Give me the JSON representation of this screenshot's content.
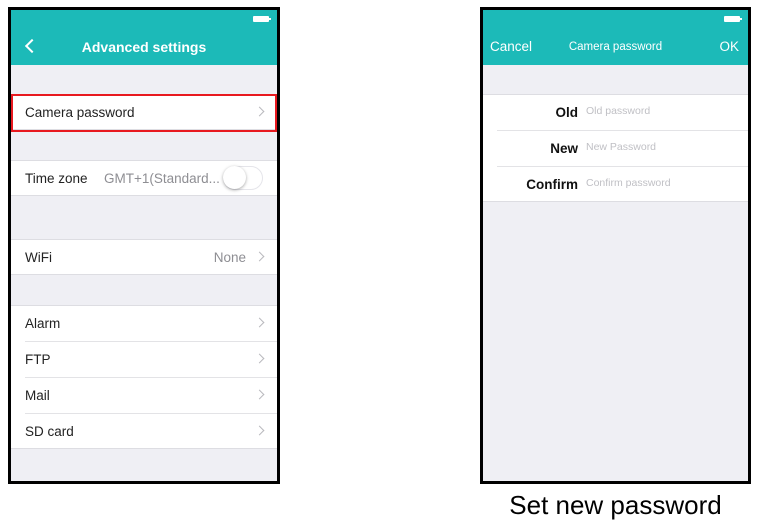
{
  "advanced_settings": {
    "title": "Advanced settings",
    "camera_password_label": "Camera password",
    "time_zone": {
      "label": "Time zone",
      "value": "GMT+1(Standard...",
      "enabled": false
    },
    "wifi": {
      "label": "WiFi",
      "value": "None"
    },
    "items": [
      {
        "label": "Alarm"
      },
      {
        "label": "FTP"
      },
      {
        "label": "Mail"
      },
      {
        "label": "SD card"
      }
    ]
  },
  "camera_password": {
    "cancel_label": "Cancel",
    "title": "Camera password",
    "ok_label": "OK",
    "fields": [
      {
        "label": "Old",
        "placeholder": "Old password",
        "value": ""
      },
      {
        "label": "New",
        "placeholder": "New Password",
        "value": ""
      },
      {
        "label": "Confirm",
        "placeholder": "Confirm password",
        "value": ""
      }
    ]
  },
  "caption": "Set new password",
  "colors": {
    "accent": "#1cbab8",
    "highlight": "#e8191f",
    "background": "#efeff4"
  },
  "icons": [
    "back-chevron-icon",
    "chevron-right-icon",
    "battery-icon"
  ]
}
